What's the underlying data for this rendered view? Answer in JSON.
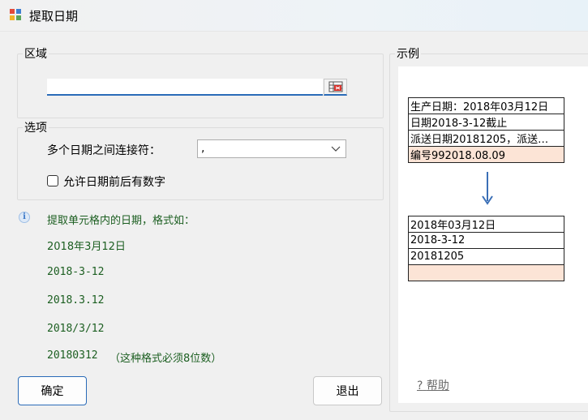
{
  "window": {
    "title": "提取日期"
  },
  "area": {
    "legend": "区域",
    "input_value": ""
  },
  "options": {
    "legend": "选项",
    "separator_label": "多个日期之间连接符：",
    "separator_value": ",",
    "allow_digits_label": "允许日期前后有数字",
    "allow_digits_checked": false
  },
  "info": {
    "description": "提取单元格内的日期，格式如：",
    "formats": [
      "2018年3月12日",
      "2018-3-12",
      "2018.3.12",
      "2018/3/12"
    ],
    "format_last": "20180312",
    "format_last_note": "（这种格式必须8位数）"
  },
  "buttons": {
    "ok": "确定",
    "exit": "退出"
  },
  "example": {
    "legend": "示例",
    "source_rows": [
      "生产日期：2018年03月12日",
      "日期2018-3-12截止",
      "派送日期20181205，派送…",
      "编号992018.08.09"
    ],
    "result_rows": [
      "2018年03月12日",
      "2018-3-12",
      "20181205",
      ""
    ],
    "highlight_color": "#fce4d6",
    "arrow_color": "#3b6fb6"
  },
  "help": {
    "label": "帮助",
    "icon": "question-mark"
  },
  "colors": {
    "accent": "#2a6bb8",
    "info_text": "#1b5e20"
  }
}
